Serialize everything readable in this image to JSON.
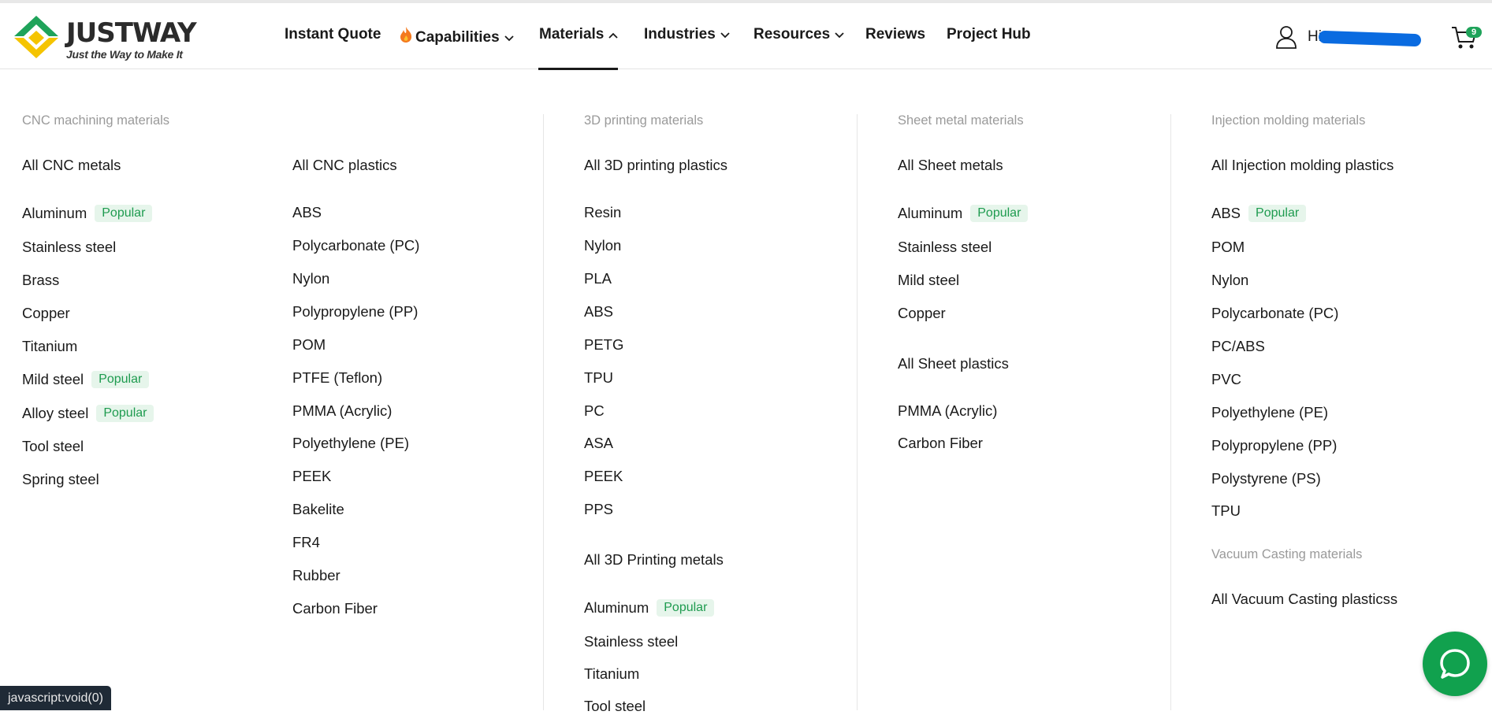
{
  "brand": {
    "name": "JUSTWAY",
    "tagline": "Just the Way to Make It",
    "colors": {
      "yellow": "#f5c400",
      "green": "#1fa35a"
    }
  },
  "nav": {
    "instant_quote": "Instant Quote",
    "capabilities": "Capabilities",
    "materials": "Materials",
    "industries": "Industries",
    "resources": "Resources",
    "reviews": "Reviews",
    "project_hub": "Project Hub",
    "active": "Materials"
  },
  "user": {
    "greeting": "Hi",
    "cart_count": "9"
  },
  "badge_label": "Popular",
  "cnc": {
    "title": "CNC machining materials",
    "metals_all": "All CNC metals",
    "metals": [
      "Aluminum",
      "Stainless steel",
      "Brass",
      "Copper",
      "Titanium",
      "Mild steel",
      "Alloy steel",
      "Tool steel",
      "Spring steel"
    ],
    "plastics_all": "All CNC plastics",
    "plastics": [
      "ABS",
      "Polycarbonate (PC)",
      "Nylon",
      "Polypropylene (PP)",
      "POM",
      "PTFE (Teflon)",
      "PMMA (Acrylic)",
      "Polyethylene (PE)",
      "PEEK",
      "Bakelite",
      "FR4",
      "Rubber",
      "Carbon Fiber"
    ]
  },
  "printing": {
    "title": "3D printing materials",
    "plastics_all": "All 3D printing plastics",
    "plastics": [
      "Resin",
      "Nylon",
      "PLA",
      "ABS",
      "PETG",
      "TPU",
      "PC",
      "ASA",
      "PEEK",
      "PPS"
    ],
    "metals_all": "All 3D Printing metals",
    "metals": [
      "Aluminum",
      "Stainless steel",
      "Titanium",
      "Tool steel"
    ]
  },
  "sheet": {
    "title": "Sheet metal materials",
    "metals_all": "All Sheet metals",
    "metals": [
      "Aluminum",
      "Stainless steel",
      "Mild steel",
      "Copper"
    ],
    "plastics_all": "All Sheet plastics",
    "plastics": [
      "PMMA (Acrylic)",
      "Carbon Fiber"
    ]
  },
  "injection": {
    "title": "Injection molding materials",
    "plastics_all": "All Injection molding plastics",
    "plastics": [
      "ABS",
      "POM",
      "Nylon",
      "Polycarbonate (PC)",
      "PC/ABS",
      "PVC",
      "Polyethylene (PE)",
      "Polypropylene (PP)",
      "Polystyrene (PS)",
      "TPU"
    ]
  },
  "vacuum": {
    "title": "Vacuum Casting materials",
    "plastics_all": "All Vacuum Casting plasticss"
  },
  "status_bar": "javascript:void(0)"
}
